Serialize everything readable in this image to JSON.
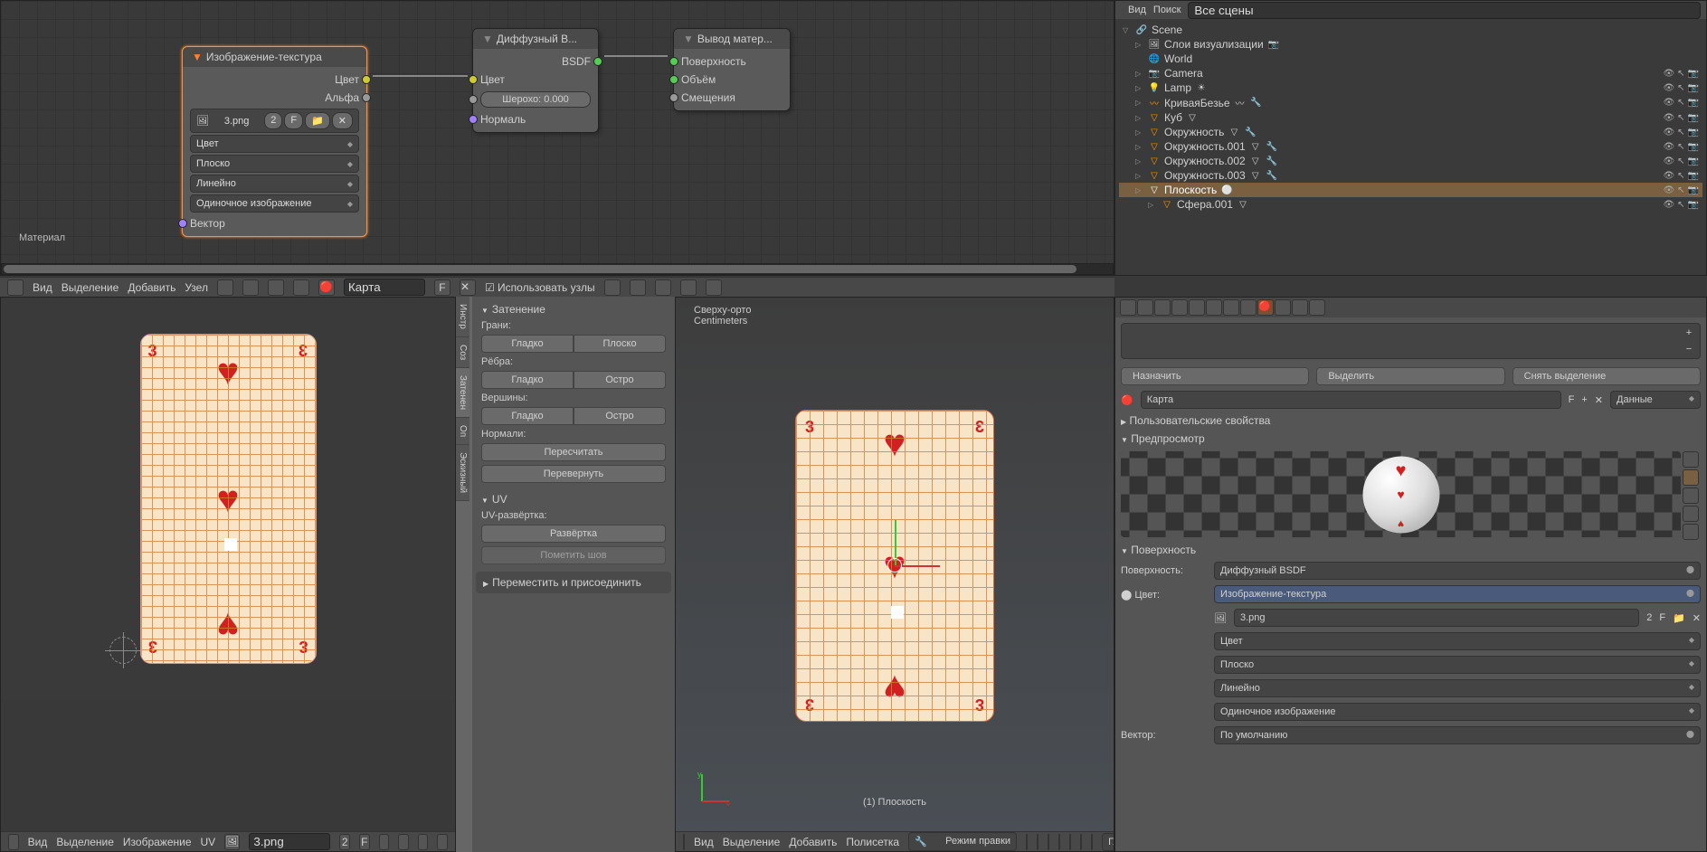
{
  "node_editor": {
    "nodes": {
      "image_texture": {
        "title": "Изображение-текстура",
        "outputs": {
          "color": "Цвет",
          "alpha": "Альфа"
        },
        "image_file": "3.png",
        "image_users": "2",
        "f_btn": "F",
        "dropdowns": [
          "Цвет",
          "Плоско",
          "Линейно",
          "Одиночное изображение"
        ],
        "inputs": {
          "vector": "Вектор"
        }
      },
      "diffuse": {
        "title": "Диффузный B...",
        "outputs": {
          "bsdf": "BSDF"
        },
        "inputs": {
          "color": "Цвет",
          "normal": "Нормаль"
        },
        "roughness_label": "Шерохо:",
        "roughness_value": "0.000"
      },
      "output": {
        "title": "Вывод матер...",
        "inputs": {
          "surface": "Поверхность",
          "volume": "Объём",
          "displacement": "Смещения"
        }
      }
    },
    "corner_label": "Материал",
    "header": {
      "menus": [
        "Вид",
        "Выделение",
        "Добавить",
        "Узел"
      ],
      "material": "Карта",
      "f_btn": "F",
      "use_nodes": "Использовать узлы"
    }
  },
  "uv_editor": {
    "card_value": "3",
    "header": {
      "menus": [
        "Вид",
        "Выделение",
        "Изображение",
        "UV"
      ],
      "image": "3.png",
      "image_users": "2",
      "f_btn": "F"
    }
  },
  "tools": {
    "sections": {
      "shading": {
        "title": "Затенение",
        "faces": "Грани:",
        "edges": "Рёбра:",
        "verts": "Вершины:",
        "smooth": "Гладко",
        "flat": "Плоско",
        "sharp": "Остро",
        "normals": "Нормали:",
        "recalc": "Пересчитать",
        "flip": "Перевернуть"
      },
      "uv": {
        "title": "UV",
        "unwrap_label": "UV-развёртка:",
        "unwrap": "Развёртка",
        "mark_seam": "Пометить шов"
      },
      "move_attach": "Переместить и присоединить"
    },
    "tabs": [
      "Инстр",
      "Соз",
      "Затенен",
      "Оп",
      "Эскизный"
    ]
  },
  "viewport": {
    "info1": "Сверху-орто",
    "info2": "Centimeters",
    "object_label": "(1) Плоскость",
    "header": {
      "menus": [
        "Вид",
        "Выделение",
        "Добавить",
        "Полисетка"
      ],
      "mode": "Режим правки",
      "orientation": "Глобально"
    }
  },
  "outliner": {
    "view": "Вид",
    "search": "Поиск",
    "search_placeholder": "Все сцены",
    "scene": "Scene",
    "render_layers": "Слои визуализации",
    "world": "World",
    "objects": [
      {
        "name": "Camera",
        "type": "camera"
      },
      {
        "name": "Lamp",
        "type": "lamp"
      },
      {
        "name": "КриваяБезье",
        "type": "curve"
      },
      {
        "name": "Куб",
        "type": "mesh"
      },
      {
        "name": "Окружность",
        "type": "mesh"
      },
      {
        "name": "Окружность.001",
        "type": "mesh"
      },
      {
        "name": "Окружность.002",
        "type": "mesh"
      },
      {
        "name": "Окружность.003",
        "type": "mesh"
      },
      {
        "name": "Плоскость",
        "type": "mesh",
        "selected": true
      },
      {
        "name": "Сфера.001",
        "type": "mesh"
      }
    ]
  },
  "properties": {
    "assign": "Назначить",
    "select": "Выделить",
    "deselect": "Снять выделение",
    "material_name": "Карта",
    "f_btn": "F",
    "data_dropdown": "Данные",
    "custom_props": "Пользовательские свойства",
    "preview": "Предпросмотр",
    "surface_panel": "Поверхность",
    "surface_label": "Поверхность:",
    "surface_value": "Диффузный BSDF",
    "color_label": "Цвет:",
    "color_value": "Изображение-текстура",
    "image_file": "3.png",
    "image_users": "2",
    "dropdowns": [
      "Цвет",
      "Плоско",
      "Линейно",
      "Одиночное изображение"
    ],
    "vector_label": "Вектор:",
    "vector_value": "По умолчанию"
  }
}
